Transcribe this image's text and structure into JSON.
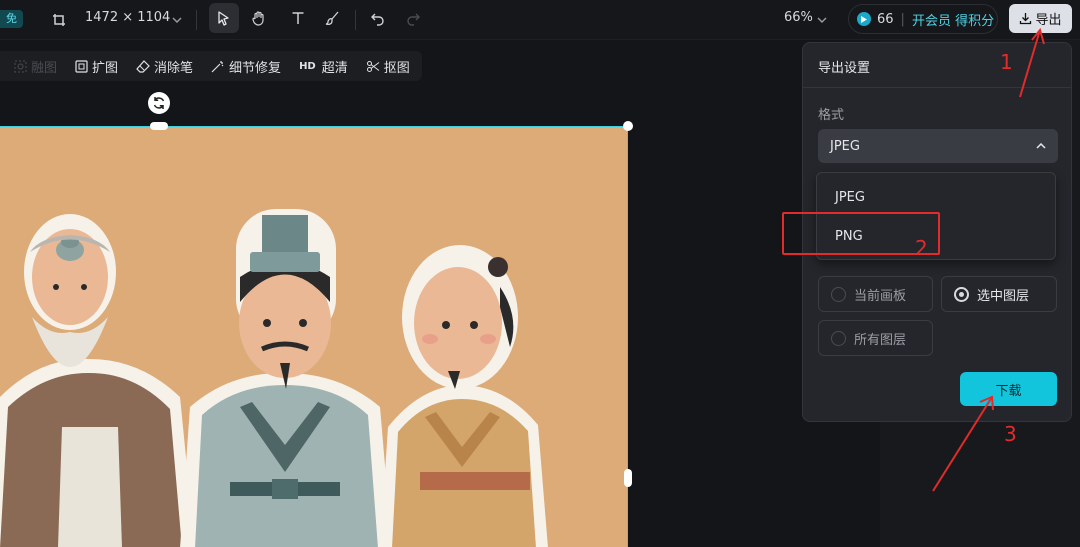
{
  "topbar": {
    "badge": "免",
    "canvas_size": "1472 × 1104",
    "zoom": "66%",
    "credits": "66",
    "vip_label": "开会员 得积分",
    "export_label": "导出"
  },
  "tools": [
    "select-icon",
    "hand-icon",
    "text-icon",
    "brush-icon",
    "undo-icon",
    "redo-icon"
  ],
  "edit_toolbar": {
    "items": [
      {
        "label": "融图",
        "icon": "blend-icon",
        "enabled": false
      },
      {
        "label": "扩图",
        "icon": "expand-icon",
        "enabled": true
      },
      {
        "label": "消除笔",
        "icon": "eraser-icon",
        "enabled": true
      },
      {
        "label": "细节修复",
        "icon": "magic-wand-icon",
        "enabled": true
      },
      {
        "label": "超清",
        "icon": "hd-icon",
        "icon_text": "HD",
        "enabled": true
      },
      {
        "label": "抠图",
        "icon": "cutout-icon",
        "enabled": true
      }
    ]
  },
  "export_panel": {
    "title": "导出设置",
    "format_label": "格式",
    "selected_format": "JPEG",
    "format_options": [
      "JPEG",
      "PNG"
    ],
    "scope_options": [
      {
        "label": "当前画板",
        "selected": false
      },
      {
        "label": "选中图层",
        "selected": true
      },
      {
        "label": "所有图层",
        "selected": false
      }
    ],
    "download_label": "下载"
  },
  "annotations": {
    "step1": "1",
    "step2": "2",
    "step3": "3",
    "color": "#e22b2b"
  },
  "colors": {
    "accent": "#12c4dc",
    "canvas_bg": "#dcab78",
    "background": "#141519"
  }
}
